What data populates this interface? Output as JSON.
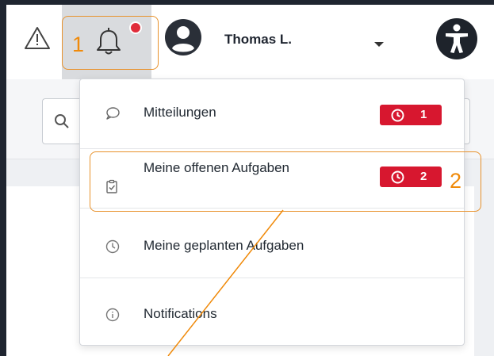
{
  "header": {
    "user_name": "Thomas L.",
    "icons": [
      "warning-icon",
      "bell-icon",
      "avatar",
      "chevron-down-icon",
      "accessibility-icon"
    ],
    "notification_dot_color": "#e02c3a"
  },
  "dropdown": {
    "items": [
      {
        "label": "Mitteilungen",
        "icon": "speech-bubble-icon",
        "badge": "1"
      },
      {
        "label": "Meine offenen Aufgaben",
        "icon": "clipboard-check-icon",
        "badge": "2"
      },
      {
        "label": "Meine geplanten Aufgaben",
        "icon": "clock-icon"
      },
      {
        "label": "Notifications",
        "icon": "info-icon"
      }
    ]
  },
  "annotations": {
    "label_1": "1",
    "label_2": "2",
    "color": "#f08a0a"
  },
  "colors": {
    "badge_red": "#d7172f",
    "dark_frame": "#1f2530"
  }
}
